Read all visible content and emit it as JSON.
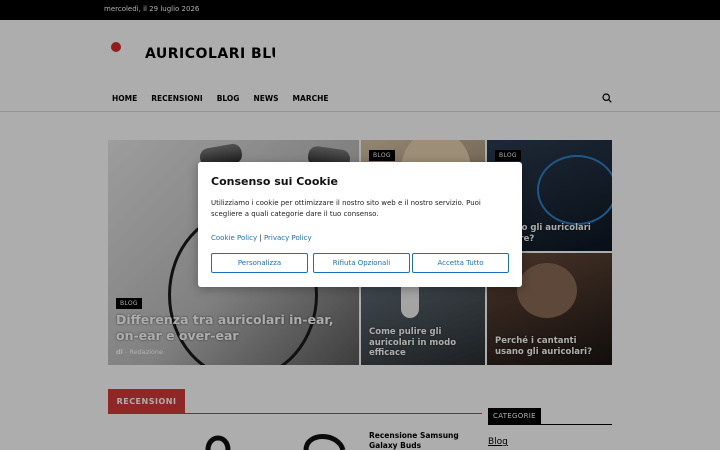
{
  "topbar": {
    "date": "mercoledì, il 29 luglio 2026"
  },
  "site": {
    "title": "AURICOLARI BLU"
  },
  "nav": {
    "items": [
      "HOME",
      "RECENSIONI",
      "BLOG",
      "NEWS",
      "MARCHE"
    ],
    "search_icon": "search-icon"
  },
  "featured": {
    "big": {
      "tag": "BLOG",
      "title": "Differenza tra auricolari in-ear, on-ear e over-ear",
      "author_prefix": "di",
      "author": "- Redazione"
    },
    "top_middle": {
      "tag": "BLOG"
    },
    "top_right": {
      "tag": "BLOG",
      "title": "...sono gli auricolari ...more?"
    },
    "bottom_middle": {
      "title": "Come pulire gli auricolari in modo efficace"
    },
    "bottom_right": {
      "title": "Perché i cantanti usano gli auricolari?"
    }
  },
  "sections": {
    "reviews_label": "RECENSIONI",
    "categories_label": "CATEGORIE",
    "categories": [
      "Blog"
    ],
    "review_title": "Recensione Samsung Galaxy Buds"
  },
  "cookie": {
    "title": "Consenso sui Cookie",
    "body": "Utilizziamo i cookie per ottimizzare il nostro sito web e il nostro servizio. Puoi scegliere a quali categorie dare il tuo consenso.",
    "policy_link": "Cookie Policy",
    "separator": "|",
    "privacy_link": "Privacy Policy",
    "buttons": [
      "Personalizza",
      "Rifiuta Opzionali",
      "Accetta Tutto"
    ]
  },
  "colors": {
    "accent": "#d33a3a",
    "link": "#1c6fb8"
  }
}
